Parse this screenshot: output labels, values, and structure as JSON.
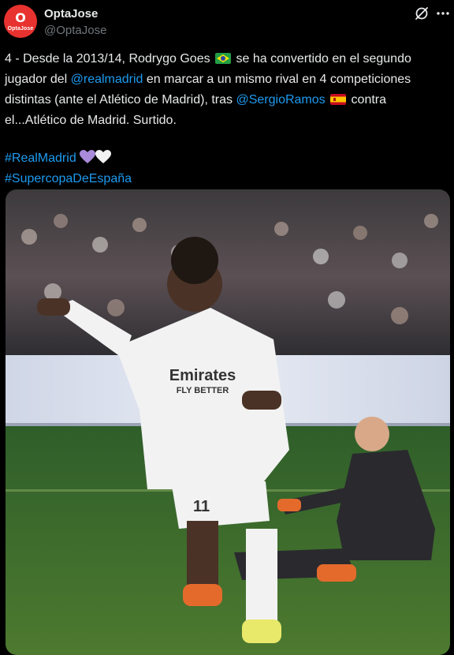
{
  "author": {
    "display_name": "OptaJose",
    "handle": "@OptaJose",
    "avatar_text": "OptaJose"
  },
  "tweet": {
    "line1_a": "4 - Desde la 2013/14, Rodrygo Goes ",
    "line1_b": " se ha convertido en el segundo",
    "line2_a": "jugador del ",
    "line2_mention": "@realmadrid",
    "line2_b": " en marcar a un mismo rival en 4 competiciones",
    "line3_a": "distintas (ante el Atlético de Madrid), tras ",
    "line3_mention": "@SergioRamos",
    "line3_b": " contra",
    "line4": "el...Atlético de Madrid. Surtido.",
    "hashtag1": "#RealMadrid",
    "hashtag2": "#SupercopaDeEspaña"
  },
  "media": {
    "jersey_sponsor": "Emirates",
    "jersey_sponsor_sub": "FLY BETTER",
    "jersey_number": "11"
  },
  "icons": {
    "flag1": "brazil-flag-icon",
    "flag2": "spain-flag-icon",
    "hearts": [
      "purple-heart-icon",
      "white-heart-icon"
    ],
    "grok": "grok-icon",
    "more": "more-icon"
  },
  "colors": {
    "background": "#000000",
    "text": "#e7e9ea",
    "secondary": "#71767b",
    "link": "#1d9bf0",
    "avatar": "#e8322f"
  }
}
